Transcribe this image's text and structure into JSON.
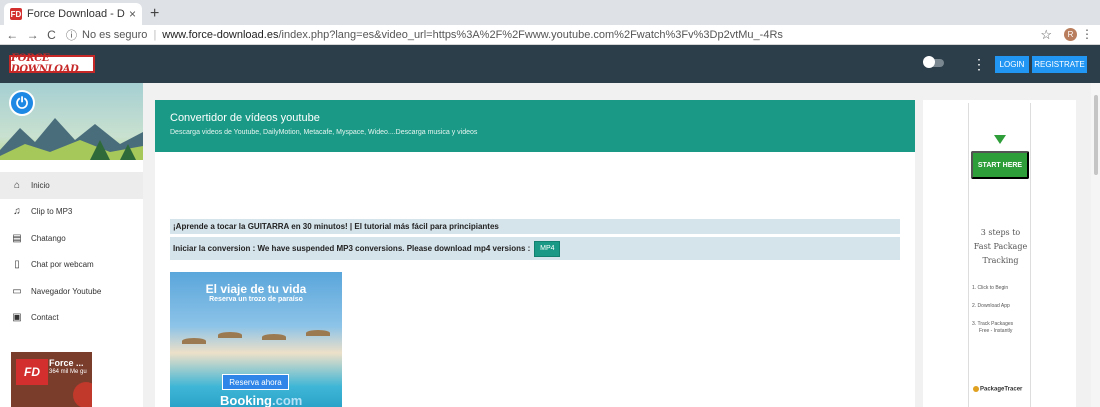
{
  "browser": {
    "tab_title": "Force Download - Descargar, c",
    "tab_favicon": "FD",
    "close_glyph": "×",
    "new_tab_glyph": "+",
    "nav_back": "←",
    "nav_forward": "→",
    "nav_reload": "C",
    "info_glyph": "ⓘ",
    "insecure_label": "No es seguro",
    "separator": "|",
    "url_host": "www.force-download.es",
    "url_path": "/index.php?lang=es&video_url=https%3A%2F%2Fwww.youtube.com%2Fwatch%3Fv%3Dp2vtMu_-4Rs",
    "star_glyph": "☆",
    "profile_initial": "R",
    "menu_glyph": "⋮"
  },
  "header": {
    "logo_text": "FORCE DOWNLOAD",
    "kebab_glyph": "⋮",
    "login_label": "LOGIN",
    "register_label": "REGISTRATE"
  },
  "sidebar": {
    "power_glyph": "⏻",
    "items": [
      {
        "label": "Inicio",
        "icon": "home-icon",
        "glyph": "⌂",
        "active": true
      },
      {
        "label": "Clip to MP3",
        "icon": "music-library-icon",
        "glyph": "♫",
        "active": false
      },
      {
        "label": "Chatango",
        "icon": "chat-icon",
        "glyph": "▤",
        "active": false
      },
      {
        "label": "Chat por webcam",
        "icon": "phone-icon",
        "glyph": "▯",
        "active": false
      },
      {
        "label": "Navegador Youtube",
        "icon": "monitor-icon",
        "glyph": "▭",
        "active": false
      },
      {
        "label": "Contact",
        "icon": "contact-card-icon",
        "glyph": "▣",
        "active": false
      }
    ],
    "fb_card": {
      "logo": "FD",
      "name": "Force ...",
      "likes": "364 mil Me gu"
    }
  },
  "main": {
    "title": "Convertidor de vídeos youtube",
    "subtitle": "Descarga videos de Youtube, DailyMotion, Metacafe, Myspace, Wideo....Descarga musica y videos",
    "guitar_text": "¡Aprende a tocar la GUITARRA en 30 minutos! | El tutorial más fácil para principiantes",
    "conversion_text": "Iniciar la conversion : We have suspended MP3 conversions. Please download mp4 versions :",
    "mp4_label": "MP4",
    "ad": {
      "title": "El viaje de tu vida",
      "subtitle": "Reserva un trozo de paraíso",
      "cta": "Reserva ahora",
      "brand": "Booking",
      "brand_suffix": ".com"
    }
  },
  "right_ad": {
    "cta": "START HERE",
    "heading_line1": "3 steps to",
    "heading_line2": "Fast Package",
    "heading_line3": "Tracking",
    "step1": "1. Click to Begin",
    "step2": "2. Download App",
    "step3a": "3. Track Packages",
    "step3b": "Free - Instantly",
    "brand": "PackageTracer"
  },
  "colors": {
    "header_bg": "#2c3e4a",
    "accent_teal": "#1a9a86",
    "button_blue": "#2196f3",
    "cta_green": "#2e9e3a"
  }
}
